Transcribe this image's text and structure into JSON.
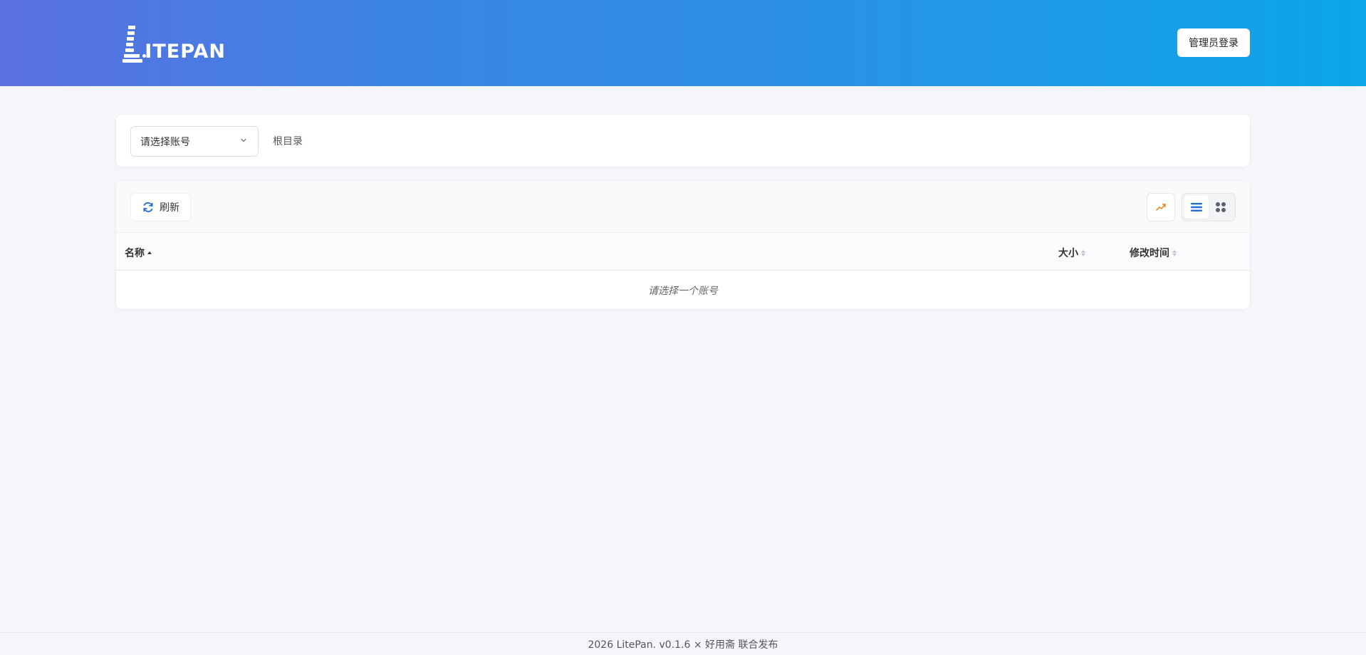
{
  "header": {
    "logo_text": "ITEPAN",
    "admin_login_label": "管理员登录"
  },
  "nav": {
    "account_select_placeholder": "请选择账号",
    "breadcrumb_root": "根目录"
  },
  "toolbar": {
    "refresh_label": "刷新"
  },
  "table": {
    "columns": {
      "name": "名称",
      "size": "大小",
      "modified": "修改时间"
    },
    "empty_message": "请选择一个账号"
  },
  "footer": {
    "text": "2026 LitePan. v0.1.6 × 好用斋 联合发布"
  },
  "colors": {
    "header_gradient_start": "#5a6fe0",
    "header_gradient_end": "#0aa5ea",
    "accent_blue": "#1f6fd6",
    "chart_icon_orange": "#e8872a"
  }
}
